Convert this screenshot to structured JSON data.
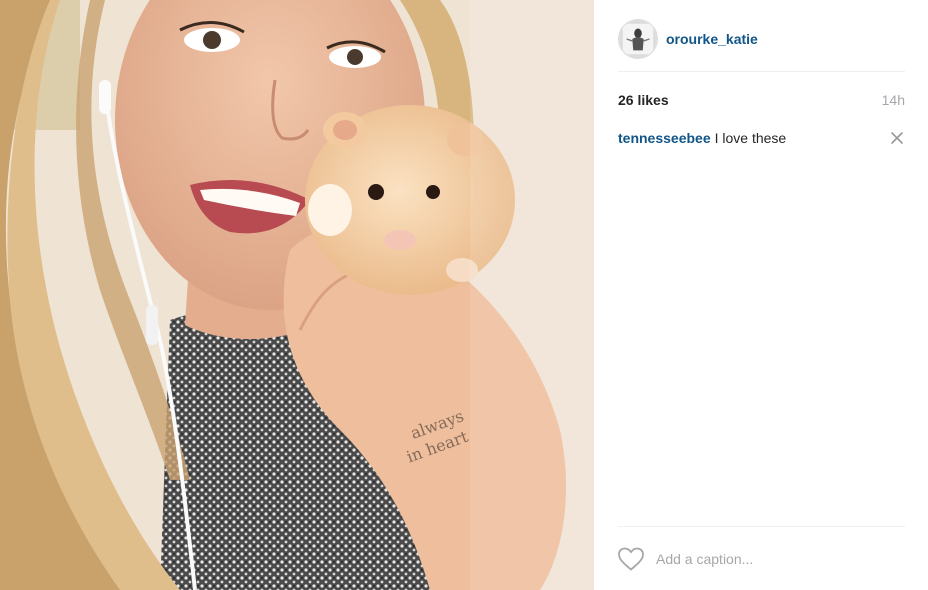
{
  "photo": {
    "alt_icon": "photo-image"
  },
  "header": {
    "avatar_icon": "profile-avatar",
    "username": "orourke_katie"
  },
  "meta": {
    "likes": "26 likes",
    "timestamp": "14h"
  },
  "comments": [
    {
      "user": "tennesseebee",
      "text": "I love these",
      "delete_icon": "close-icon"
    }
  ],
  "footer": {
    "like_icon": "heart-outline-icon",
    "caption_placeholder": "Add a caption..."
  },
  "colors": {
    "link": "#125688",
    "text": "#262626",
    "muted": "#a5a7aa",
    "divider": "#efefef"
  }
}
